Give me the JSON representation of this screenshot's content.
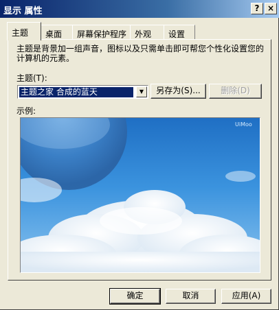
{
  "window": {
    "title": "显示 属性",
    "help_button": "?",
    "close_button": "×"
  },
  "tabs": [
    {
      "label": "主题",
      "active": true
    },
    {
      "label": "桌面",
      "active": false
    },
    {
      "label": "屏幕保护程序",
      "active": false
    },
    {
      "label": "外观",
      "active": false
    },
    {
      "label": "设置",
      "active": false
    }
  ],
  "theme_page": {
    "description": "主题是背景加一组声音，图标以及只需单击即可帮您个性化设置您的计算机的元素。",
    "theme_label": "主题(T):",
    "theme_value": "主题之家 合成的蓝天",
    "save_as_button": "另存为(S)...",
    "delete_button": "删除(D)",
    "sample_label": "示例:",
    "preview_watermark": "UiMoo"
  },
  "footer": {
    "ok_button": "确定",
    "cancel_button": "取消",
    "apply_button": "应用(A)"
  },
  "colors": {
    "title_bar_start": "#0a246a",
    "dialog_face": "#ece9d8",
    "selection": "#0a246a",
    "sky": "#2f86d6"
  }
}
